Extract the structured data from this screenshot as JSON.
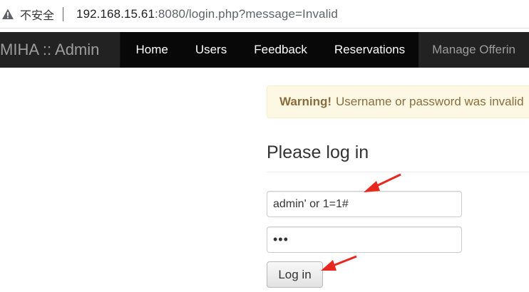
{
  "browser": {
    "security_label": "不安全",
    "url_host": "192.168.15.61",
    "url_rest": ":8080/login.php?message=Invalid",
    "icons": {
      "security": "warning-triangle-icon"
    }
  },
  "navbar": {
    "brand": "MIHA :: Admin",
    "items": [
      {
        "label": "Home"
      },
      {
        "label": "Users"
      },
      {
        "label": "Feedback"
      },
      {
        "label": "Reservations"
      },
      {
        "label": "Manage Offerin"
      }
    ]
  },
  "alert": {
    "strong": "Warning!",
    "message": "Username or password was invalid"
  },
  "login": {
    "heading": "Please log in",
    "username_value": "admin' or 1=1#",
    "password_value": "•••",
    "button_label": "Log in"
  },
  "annotations": {
    "arrow_color": "#e8281e"
  }
}
